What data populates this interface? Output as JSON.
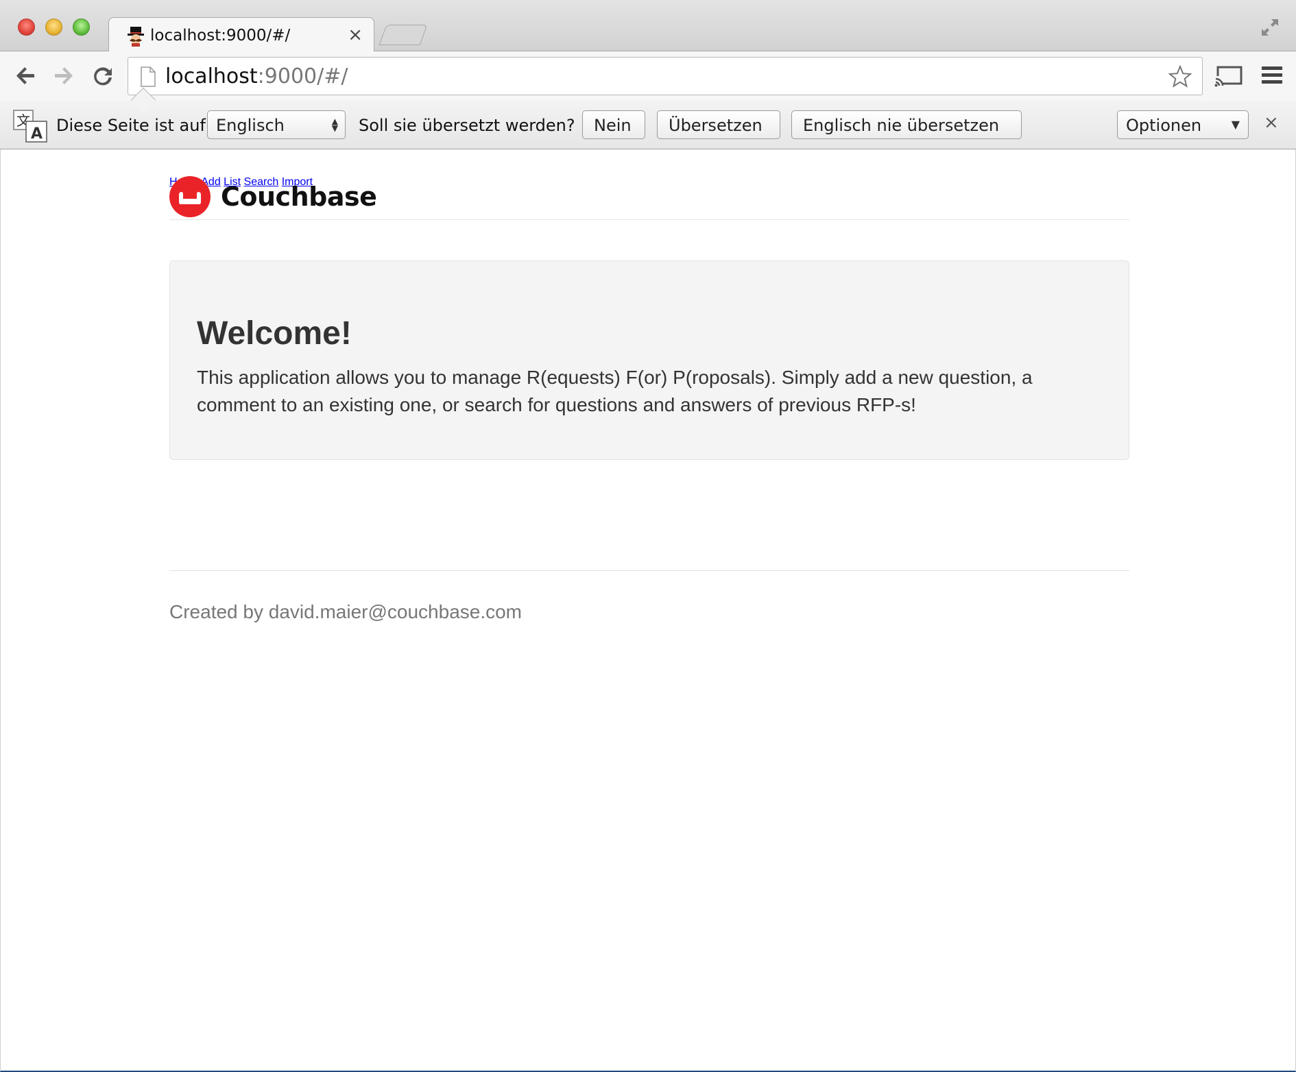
{
  "browser": {
    "tab": {
      "title": "localhost:9000/#/",
      "close_glyph": "×",
      "favicon": "hat-mustache-favicon"
    },
    "omnibox": {
      "host": "localhost",
      "rest": ":9000/#/"
    },
    "icons": {
      "back": "back-arrow-icon",
      "forward": "forward-arrow-icon",
      "reload": "reload-icon",
      "star": "star-icon",
      "cast": "cast-icon",
      "menu": "hamburger-menu-icon"
    }
  },
  "translate_bar": {
    "prefix": "Diese Seite ist auf",
    "language_select": "Englisch",
    "question": "Soll sie übersetzt werden?",
    "no_button": "Nein",
    "translate_button": "Übersetzen",
    "never_button": "Englisch nie übersetzen",
    "options_select": "Optionen",
    "close_glyph": "×"
  },
  "site": {
    "brand": "Couchbase",
    "nav": [
      "Home",
      "Add",
      "List",
      "Search",
      "Import"
    ],
    "jumbotron": {
      "title": "Welcome!",
      "text": "This application allows you to manage R(equests) F(or) P(roposals). Simply add a new question, a comment to an existing one, or search for questions and answers of previous RFP-s!"
    },
    "footer": "Created by david.maier@couchbase.com"
  },
  "colors": {
    "link": "#337ab7",
    "brand_red": "#ea2328",
    "jumbotron_bg": "#f4f4f4",
    "footer_text": "#777777"
  }
}
